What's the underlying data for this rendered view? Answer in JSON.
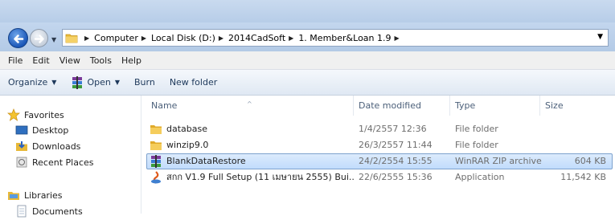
{
  "addressBar": {
    "crumbs": [
      "Computer",
      "Local Disk (D:)",
      "2014CadSoft",
      "1. Member&Loan 1.9"
    ]
  },
  "menu": [
    "File",
    "Edit",
    "View",
    "Tools",
    "Help"
  ],
  "commandBar": {
    "organize": "Organize",
    "open": "Open",
    "burn": "Burn",
    "newFolder": "New folder"
  },
  "navPane": {
    "favorites": "Favorites",
    "desktop": "Desktop",
    "downloads": "Downloads",
    "recentPlaces": "Recent Places",
    "libraries": "Libraries",
    "documents": "Documents"
  },
  "columns": {
    "name": "Name",
    "dateModified": "Date modified",
    "type": "Type",
    "size": "Size"
  },
  "files": [
    {
      "name": "database",
      "date": "1/4/2557 12:36",
      "type": "File folder",
      "size": "",
      "icon": "folder-icon"
    },
    {
      "name": "winzip9.0",
      "date": "26/3/2557 11:44",
      "type": "File folder",
      "size": "",
      "icon": "folder-icon"
    },
    {
      "name": "BlankDataRestore",
      "date": "24/2/2554 15:55",
      "type": "WinRAR ZIP archive",
      "size": "604 KB",
      "icon": "winrar-icon",
      "selected": true
    },
    {
      "name": "สกก V1.9 Full Setup (11 เมษายน 2555) Bui...",
      "date": "22/6/2555 15:36",
      "type": "Application",
      "size": "11,542 KB",
      "icon": "installer-icon"
    }
  ],
  "colors": {
    "selection": "#c1dcfc",
    "selectionBorder": "#7da2ce",
    "folder": "#e8b938"
  }
}
